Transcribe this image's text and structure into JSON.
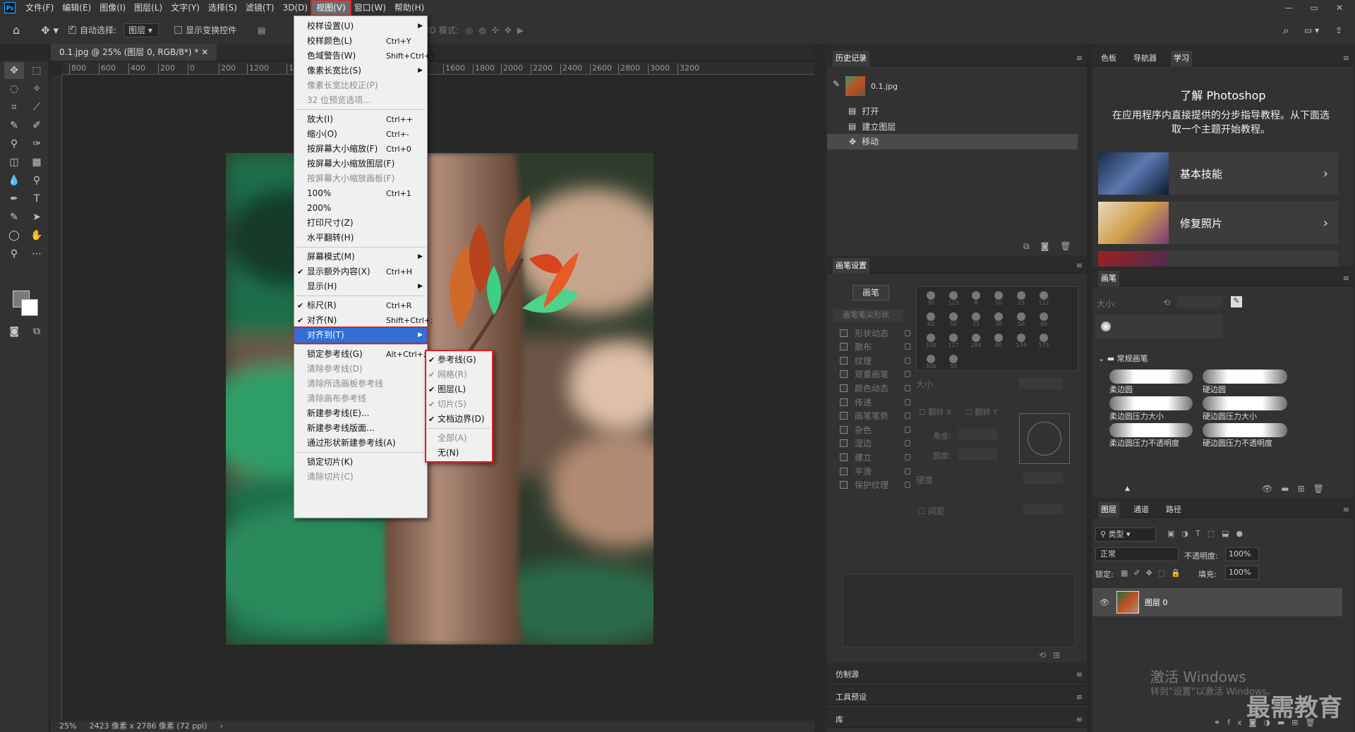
{
  "app": {
    "logo": "Ps"
  },
  "menubar": {
    "items": [
      "文件(F)",
      "编辑(E)",
      "图像(I)",
      "图层(L)",
      "文字(Y)",
      "选择(S)",
      "滤镜(T)",
      "3D(D)",
      "视图(V)",
      "窗口(W)",
      "帮助(H)"
    ],
    "active_index": 8
  },
  "window_controls": {
    "minimize": "—",
    "restore": "▭",
    "close": "✕"
  },
  "options_bar": {
    "auto_select_label": "自动选择:",
    "auto_select_checked": true,
    "layer_select": "图层",
    "show_transform_label": "显示变换控件",
    "mode3d_label": "3D 模式:",
    "more": "•••"
  },
  "document": {
    "tab_title": "0.1.jpg @ 25% (图层 0, RGB/8*) *",
    "ruler_ticks": [
      "800",
      "600",
      "400",
      "200",
      "0",
      "200",
      "1200",
      "1400",
      "1600",
      "1800",
      "2000",
      "2200",
      "2400",
      "2600",
      "2800",
      "3000",
      "3200"
    ],
    "zoom": "25%",
    "status_info": "2423 像素 x 2786 像素 (72 ppi)",
    "status_arrow": "›"
  },
  "view_menu": {
    "items": [
      {
        "label": "校样设置(U)",
        "shortcut": "",
        "submenu": true,
        "disabled": false,
        "checked": false
      },
      {
        "label": "校样颜色(L)",
        "shortcut": "Ctrl+Y",
        "submenu": false,
        "disabled": false,
        "checked": false
      },
      {
        "label": "色域警告(W)",
        "shortcut": "Shift+Ctrl+Y",
        "submenu": false,
        "disabled": false,
        "checked": false
      },
      {
        "label": "像素长宽比(S)",
        "shortcut": "",
        "submenu": true,
        "disabled": false,
        "checked": false
      },
      {
        "label": "像素长宽比校正(P)",
        "shortcut": "",
        "submenu": false,
        "disabled": true,
        "checked": false
      },
      {
        "label": "32 位预览选项...",
        "shortcut": "",
        "submenu": false,
        "disabled": true,
        "checked": false
      },
      {
        "label": "放大(I)",
        "shortcut": "Ctrl++",
        "submenu": false,
        "disabled": false,
        "checked": false
      },
      {
        "label": "缩小(O)",
        "shortcut": "Ctrl+-",
        "submenu": false,
        "disabled": false,
        "checked": false
      },
      {
        "label": "按屏幕大小缩放(F)",
        "shortcut": "Ctrl+0",
        "submenu": false,
        "disabled": false,
        "checked": false
      },
      {
        "label": "按屏幕大小缩放图层(F)",
        "shortcut": "",
        "submenu": false,
        "disabled": false,
        "checked": false
      },
      {
        "label": "按屏幕大小缩放画板(F)",
        "shortcut": "",
        "submenu": false,
        "disabled": true,
        "checked": false
      },
      {
        "label": "100%",
        "shortcut": "Ctrl+1",
        "submenu": false,
        "disabled": false,
        "checked": false
      },
      {
        "label": "200%",
        "shortcut": "",
        "submenu": false,
        "disabled": false,
        "checked": false
      },
      {
        "label": "打印尺寸(Z)",
        "shortcut": "",
        "submenu": false,
        "disabled": false,
        "checked": false
      },
      {
        "label": "水平翻转(H)",
        "shortcut": "",
        "submenu": false,
        "disabled": false,
        "checked": false
      },
      {
        "label": "屏幕模式(M)",
        "shortcut": "",
        "submenu": true,
        "disabled": false,
        "checked": false
      },
      {
        "label": "显示额外内容(X)",
        "shortcut": "Ctrl+H",
        "submenu": false,
        "disabled": false,
        "checked": true
      },
      {
        "label": "显示(H)",
        "shortcut": "",
        "submenu": true,
        "disabled": false,
        "checked": false
      },
      {
        "label": "标尺(R)",
        "shortcut": "Ctrl+R",
        "submenu": false,
        "disabled": false,
        "checked": true
      },
      {
        "label": "对齐(N)",
        "shortcut": "Shift+Ctrl+;",
        "submenu": false,
        "disabled": false,
        "checked": true
      },
      {
        "label": "对齐到(T)",
        "shortcut": "",
        "submenu": true,
        "disabled": false,
        "checked": false,
        "highlighted": true
      },
      {
        "label": "锁定参考线(G)",
        "shortcut": "Alt+Ctrl+;",
        "submenu": false,
        "disabled": false,
        "checked": false
      },
      {
        "label": "清除参考线(D)",
        "shortcut": "",
        "submenu": false,
        "disabled": true,
        "checked": false
      },
      {
        "label": "清除所选画板参考线",
        "shortcut": "",
        "submenu": false,
        "disabled": true,
        "checked": false
      },
      {
        "label": "清除画布参考线",
        "shortcut": "",
        "submenu": false,
        "disabled": true,
        "checked": false
      },
      {
        "label": "新建参考线(E)...",
        "shortcut": "",
        "submenu": false,
        "disabled": false,
        "checked": false
      },
      {
        "label": "新建参考线版面...",
        "shortcut": "",
        "submenu": false,
        "disabled": false,
        "checked": false
      },
      {
        "label": "通过形状新建参考线(A)",
        "shortcut": "",
        "submenu": false,
        "disabled": false,
        "checked": false
      },
      {
        "label": "锁定切片(K)",
        "shortcut": "",
        "submenu": false,
        "disabled": false,
        "checked": false
      },
      {
        "label": "清除切片(C)",
        "shortcut": "",
        "submenu": false,
        "disabled": true,
        "checked": false
      }
    ]
  },
  "snap_submenu": {
    "items": [
      {
        "label": "参考线(G)",
        "checked": true,
        "disabled": false
      },
      {
        "label": "网格(R)",
        "checked": true,
        "disabled": true
      },
      {
        "label": "图层(L)",
        "checked": true,
        "disabled": false
      },
      {
        "label": "切片(S)",
        "checked": true,
        "disabled": true
      },
      {
        "label": "文档边界(D)",
        "checked": true,
        "disabled": false
      },
      {
        "label": "全部(A)",
        "checked": false,
        "disabled": true
      },
      {
        "label": "无(N)",
        "checked": false,
        "disabled": false
      }
    ]
  },
  "history_panel": {
    "title": "历史记录",
    "snapshot": "0.1.jpg",
    "states": [
      "打开",
      "建立图层",
      "移动"
    ],
    "selected_state": "移动"
  },
  "brush_settings_panel": {
    "title": "画笔设置",
    "brushes_button": "画笔",
    "tip_shape": "画笔笔尖形状",
    "options": [
      "形状动态",
      "散布",
      "纹理",
      "双重画笔",
      "颜色动态",
      "传递",
      "画笔笔势",
      "杂色",
      "湿边",
      "建立",
      "平滑",
      "保护纹理"
    ],
    "tip_sizes": [
      "30",
      "123",
      "8",
      "10",
      "25",
      "112",
      "60",
      "50",
      "25",
      "30",
      "50",
      "60",
      "100",
      "127",
      "284",
      "80",
      "174",
      "175",
      "306",
      "50"
    ],
    "size_label": "大小",
    "flip_x": "翻转 X",
    "flip_y": "翻转 Y",
    "angle_label": "角度:",
    "roundness_label": "圆度:",
    "hardness_label": "硬度",
    "spacing_label": "间距"
  },
  "clone_panel": {
    "title": "仿制源"
  },
  "tool_presets_panel": {
    "title": "工具预设"
  },
  "library_panel": {
    "title": "库"
  },
  "learn_panel": {
    "tabs": [
      "色板",
      "导航器",
      "学习"
    ],
    "active_tab": "学习",
    "heading": "了解 Photoshop",
    "description": "在应用程序内直接提供的分步指导教程。从下面选取一个主题开始教程。",
    "topics": [
      "基本技能",
      "修复照片"
    ]
  },
  "brushes_panel": {
    "title": "画笔",
    "size_label": "大小:",
    "group": "常规画笔",
    "brushes": [
      "柔边圆",
      "硬边圆",
      "柔边圆压力大小",
      "硬边圆压力大小",
      "柔边圆压力不透明度",
      "硬边圆压力不透明度"
    ]
  },
  "layers_panel": {
    "tabs": [
      "图层",
      "通道",
      "路径"
    ],
    "active_tab": "图层",
    "filter": "类型",
    "blend_mode": "正常",
    "opacity_label": "不透明度:",
    "opacity": "100%",
    "lock_label": "锁定:",
    "fill_label": "填充:",
    "fill": "100%",
    "layers": [
      {
        "name": "图层 0",
        "visible": true
      }
    ]
  },
  "watermark": {
    "activate": "激活 Windows",
    "activate_hint": "转到\"设置\"以激活 Windows。",
    "brand": "最需教育"
  },
  "colors": {
    "menu_highlight": "#2f6fd6",
    "annotation_red": "#e01e26",
    "ui_dark": "#323232"
  }
}
